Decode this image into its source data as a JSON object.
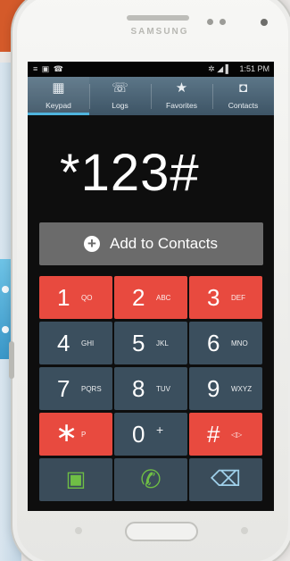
{
  "device": {
    "brand": "SAMSUNG"
  },
  "status_bar": {
    "left_icons": "≡ ▣ ☎",
    "right_icons": "✲ ◢ ▌",
    "time": "1:51 PM"
  },
  "tabs": [
    {
      "label": "Keypad",
      "icon": "keypad-icon",
      "glyph": "▦",
      "active": true
    },
    {
      "label": "Logs",
      "icon": "logs-icon",
      "glyph": "☏",
      "active": false
    },
    {
      "label": "Favorites",
      "icon": "star-icon",
      "glyph": "★",
      "active": false
    },
    {
      "label": "Contacts",
      "icon": "person-icon",
      "glyph": "◘",
      "active": false
    }
  ],
  "dial": {
    "number": "*123#"
  },
  "add_contacts": {
    "label": "Add to Contacts",
    "icon": "plus-circle-icon",
    "glyph": "+"
  },
  "keys": [
    {
      "digit": "1",
      "letters": "QO",
      "color": "#e84a3f"
    },
    {
      "digit": "2",
      "letters": "ABC",
      "color": "#e84a3f"
    },
    {
      "digit": "3",
      "letters": "DEF",
      "color": "#e84a3f"
    },
    {
      "digit": "4",
      "letters": "GHI",
      "color": "#3b4f5e"
    },
    {
      "digit": "5",
      "letters": "JKL",
      "color": "#3b4f5e"
    },
    {
      "digit": "6",
      "letters": "MNO",
      "color": "#3b4f5e"
    },
    {
      "digit": "7",
      "letters": "PQRS",
      "color": "#3b4f5e"
    },
    {
      "digit": "8",
      "letters": "TUV",
      "color": "#3b4f5e"
    },
    {
      "digit": "9",
      "letters": "WXYZ",
      "color": "#3b4f5e"
    },
    {
      "digit": "∗",
      "letters": "P",
      "color": "#e84a3f"
    },
    {
      "digit": "0",
      "letters": "+",
      "color": "#3b4f5e"
    },
    {
      "digit": "#",
      "letters": "◁▷",
      "color": "#e84a3f"
    }
  ],
  "bottom_bar": {
    "video_call": {
      "icon": "video-call-icon",
      "glyph": "▣",
      "color": "#6fbf45"
    },
    "call": {
      "icon": "phone-icon",
      "glyph": "✆",
      "color": "#6fbf45"
    },
    "backspace": {
      "icon": "backspace-icon",
      "glyph": "⌫",
      "color": "#9fd0ea"
    }
  },
  "colors": {
    "accent_red": "#e84a3f",
    "key_dark": "#3b4f5e",
    "tab_active": "#4fb4dd",
    "call_green": "#6fbf45"
  }
}
